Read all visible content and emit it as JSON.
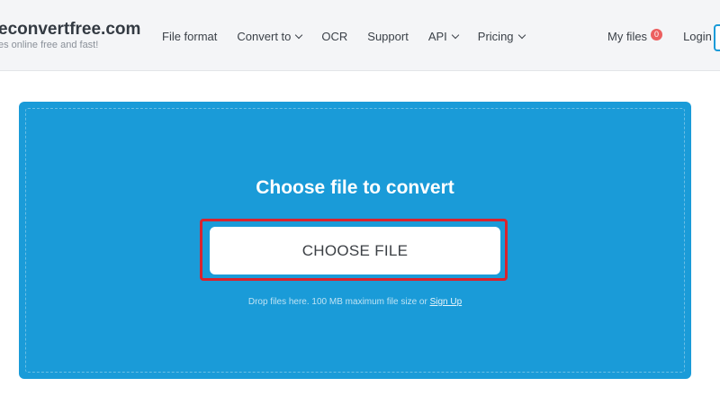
{
  "header": {
    "brand_name": "econvertfree.com",
    "brand_tagline": "es online free and fast!",
    "nav": [
      {
        "label": "File format",
        "dropdown": false
      },
      {
        "label": "Convert to",
        "dropdown": true
      },
      {
        "label": "OCR",
        "dropdown": false
      },
      {
        "label": "Support",
        "dropdown": false
      },
      {
        "label": "API",
        "dropdown": true
      },
      {
        "label": "Pricing",
        "dropdown": true
      }
    ],
    "my_files_label": "My files",
    "my_files_count": "0",
    "login_label": "Login"
  },
  "upload": {
    "title": "Choose file to convert",
    "button_label": "CHOOSE FILE",
    "hint_text": "Drop files here. 100 MB maximum file size or ",
    "signup_link": "Sign Up"
  },
  "colors": {
    "panel_blue": "#1a9bd8",
    "highlight_red": "#d9232e",
    "badge_red": "#ec5f5f",
    "header_bg": "#f4f5f7"
  }
}
